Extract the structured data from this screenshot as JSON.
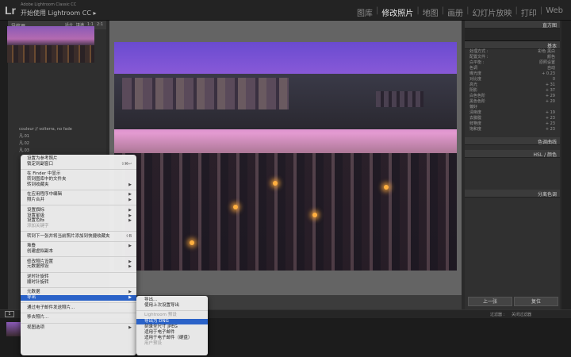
{
  "app": {
    "logo": "Lr",
    "sub": "Adobe Lightroom Classic CC",
    "title": "开始使用 Lightroom CC  ▸"
  },
  "modules": [
    {
      "label": "图库"
    },
    {
      "label": "修改照片",
      "active": true
    },
    {
      "label": "地图"
    },
    {
      "label": "画册"
    },
    {
      "label": "幻灯片放映"
    },
    {
      "label": "打印"
    },
    {
      "label": "Web"
    }
  ],
  "navigator": {
    "title": "导航器",
    "options": [
      "适合",
      "填满",
      "1:1",
      "2:1"
    ]
  },
  "collections": [
    "couleur // volterra, no fade",
    "凡.01",
    "凡.02",
    "凡.03"
  ],
  "right_panel": {
    "histogram": "直方图",
    "basic": "基本",
    "treatment": {
      "label": "处理方式 :",
      "color": "彩色",
      "bw": "黑白"
    },
    "profile": {
      "label": "配置文件 :",
      "value": "颜色"
    },
    "wb": {
      "label": "白平衡 :",
      "value": "原照设置"
    },
    "tone": {
      "label": "色调",
      "auto": "自动"
    },
    "exposure": {
      "label": "曝光度",
      "value": "+ 0.23"
    },
    "contrast": {
      "label": "对比度",
      "value": "0"
    },
    "highlights": {
      "label": "高光",
      "value": "+ 31"
    },
    "shadows": {
      "label": "阴影",
      "value": "+ 37"
    },
    "whites": {
      "label": "白色色阶",
      "value": "+ 29"
    },
    "blacks": {
      "label": "黑色色阶",
      "value": "+ 20"
    },
    "presence": {
      "label": "偏好"
    },
    "clarity": {
      "label": "清晰度",
      "value": "+ 19"
    },
    "dehaze": {
      "label": "去朦胧",
      "value": "+ 23"
    },
    "vibrance": {
      "label": "鲜艳度",
      "value": "+ 23"
    },
    "saturation": {
      "label": "饱和度",
      "value": "+ 23"
    },
    "tonecurve": "色调曲线",
    "hsl": "HSL / 颜色",
    "splittone": "分离色调",
    "prev": "上一张",
    "reset": "复位"
  },
  "filmstrip": {
    "filter": "过滤器 :",
    "filter_value": "关闭过滤器",
    "page": "1"
  },
  "context_menu": [
    {
      "label": "设置为参考照片"
    },
    {
      "label": "锁定到副窗口",
      "short": "⇧⌘↩"
    },
    {
      "sep": true
    },
    {
      "label": "在 Finder 中显示"
    },
    {
      "label": "转到图库中的文件夹"
    },
    {
      "label": "转到收藏夹",
      "arrow": true
    },
    {
      "sep": true
    },
    {
      "label": "在应用程序中编辑",
      "arrow": true
    },
    {
      "label": "照片合并",
      "arrow": true
    },
    {
      "sep": true
    },
    {
      "label": "设置旗标",
      "arrow": true
    },
    {
      "label": "设置星级",
      "arrow": true
    },
    {
      "label": "设置色标",
      "arrow": true
    },
    {
      "label": "添加关键字",
      "disabled": true
    },
    {
      "sep": true
    },
    {
      "label": "转到下一张并将当前照片添加到快捷收藏夹",
      "short": "⇧B"
    },
    {
      "sep": true
    },
    {
      "label": "堆叠",
      "arrow": true
    },
    {
      "label": "创建虚拟副本"
    },
    {
      "sep": true
    },
    {
      "label": "修改照片设置",
      "arrow": true
    },
    {
      "label": "元数据预设",
      "arrow": true
    },
    {
      "sep": true
    },
    {
      "label": "逆时针旋转"
    },
    {
      "label": "顺时针旋转"
    },
    {
      "sep": true
    },
    {
      "label": "元数据",
      "arrow": true
    },
    {
      "label": "导出",
      "arrow": true,
      "highlight": true
    },
    {
      "sep": true
    },
    {
      "label": "通过电子邮件发送照片..."
    },
    {
      "sep": true
    },
    {
      "label": "移去照片..."
    },
    {
      "sep": true
    },
    {
      "label": "视图选项",
      "arrow": true
    }
  ],
  "submenu": [
    {
      "label": "导出..."
    },
    {
      "label": "使用上次设置导出"
    },
    {
      "sep": true
    },
    {
      "label": "Lightroom 预设",
      "disabled": true
    },
    {
      "label": "导出为 DNG",
      "highlight": true
    },
    {
      "label": "刻录全尺寸 JPEG"
    },
    {
      "label": "适用于电子邮件"
    },
    {
      "label": "适用于电子邮件（硬盘）"
    },
    {
      "label": "用户预设",
      "disabled": true
    }
  ]
}
